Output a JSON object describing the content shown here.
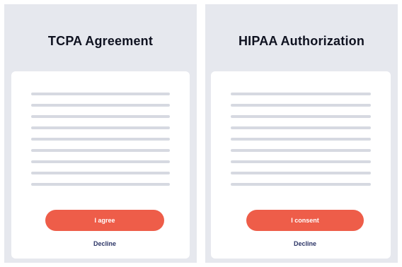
{
  "colors": {
    "panel_background": "#e6e8ee",
    "card_background": "#ffffff",
    "primary_button": "#ee5d49",
    "decline_text": "#2b3466",
    "placeholder_line": "#d6d9e1"
  },
  "tcpa": {
    "title": "TCPA Agreement",
    "agree_label": "I agree",
    "decline_label": "Decline"
  },
  "hipaa": {
    "title": "HIPAA Authorization",
    "consent_label": "I consent",
    "decline_label": "Decline"
  }
}
